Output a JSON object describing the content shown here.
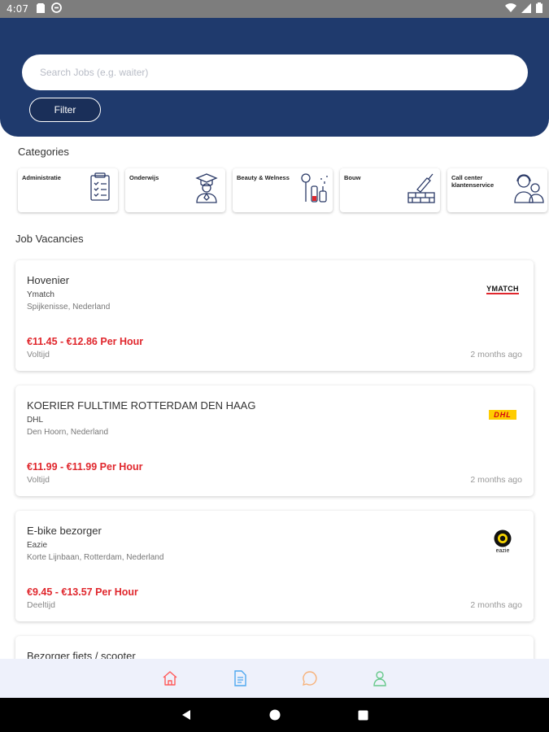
{
  "status_bar": {
    "time": "4:07"
  },
  "search": {
    "placeholder": "Search Jobs (e.g. waiter)"
  },
  "filter": {
    "label": "Filter"
  },
  "categories": {
    "title": "Categories",
    "items": [
      {
        "label": "Administratie",
        "icon": "clipboard-icon"
      },
      {
        "label": "Onderwijs",
        "icon": "graduate-icon"
      },
      {
        "label": "Beauty & Welness",
        "icon": "beauty-products-icon"
      },
      {
        "label": "Bouw",
        "icon": "brick-trowel-icon"
      },
      {
        "label": "Call center klantenservice",
        "icon": "headset-agents-icon"
      }
    ]
  },
  "vacancies": {
    "title": "Job Vacancies",
    "items": [
      {
        "title": "Hovenier",
        "company": "Ymatch",
        "location": "Spijkenisse, Nederland",
        "salary": "€11.45 - €12.86 Per Hour",
        "type": "Voltijd",
        "posted": "2 months ago",
        "logo_text": "YMATCH"
      },
      {
        "title": "KOERIER FULLTIME ROTTERDAM DEN HAAG",
        "company": "DHL",
        "location": "Den Hoorn, Nederland",
        "salary": "€11.99 - €11.99 Per Hour",
        "type": "Voltijd",
        "posted": "2 months ago",
        "logo_text": "DHL"
      },
      {
        "title": "E-bike bezorger",
        "company": "Eazie",
        "location": "Korte Lijnbaan, Rotterdam, Nederland",
        "salary": "€9.45 - €13.57 Per Hour",
        "type": "Deeltijd",
        "posted": "2 months ago",
        "logo_text": "eazie"
      },
      {
        "title": "Bezorger fiets / scooter"
      }
    ]
  },
  "bottom_nav": [
    {
      "icon": "home-icon",
      "color": "#ff5b5b"
    },
    {
      "icon": "document-icon",
      "color": "#4fa8f0"
    },
    {
      "icon": "chat-icon",
      "color": "#f7b27a"
    },
    {
      "icon": "profile-icon",
      "color": "#67c98b"
    }
  ],
  "colors": {
    "header": "#1f3a6d",
    "salary": "#e0272d"
  }
}
